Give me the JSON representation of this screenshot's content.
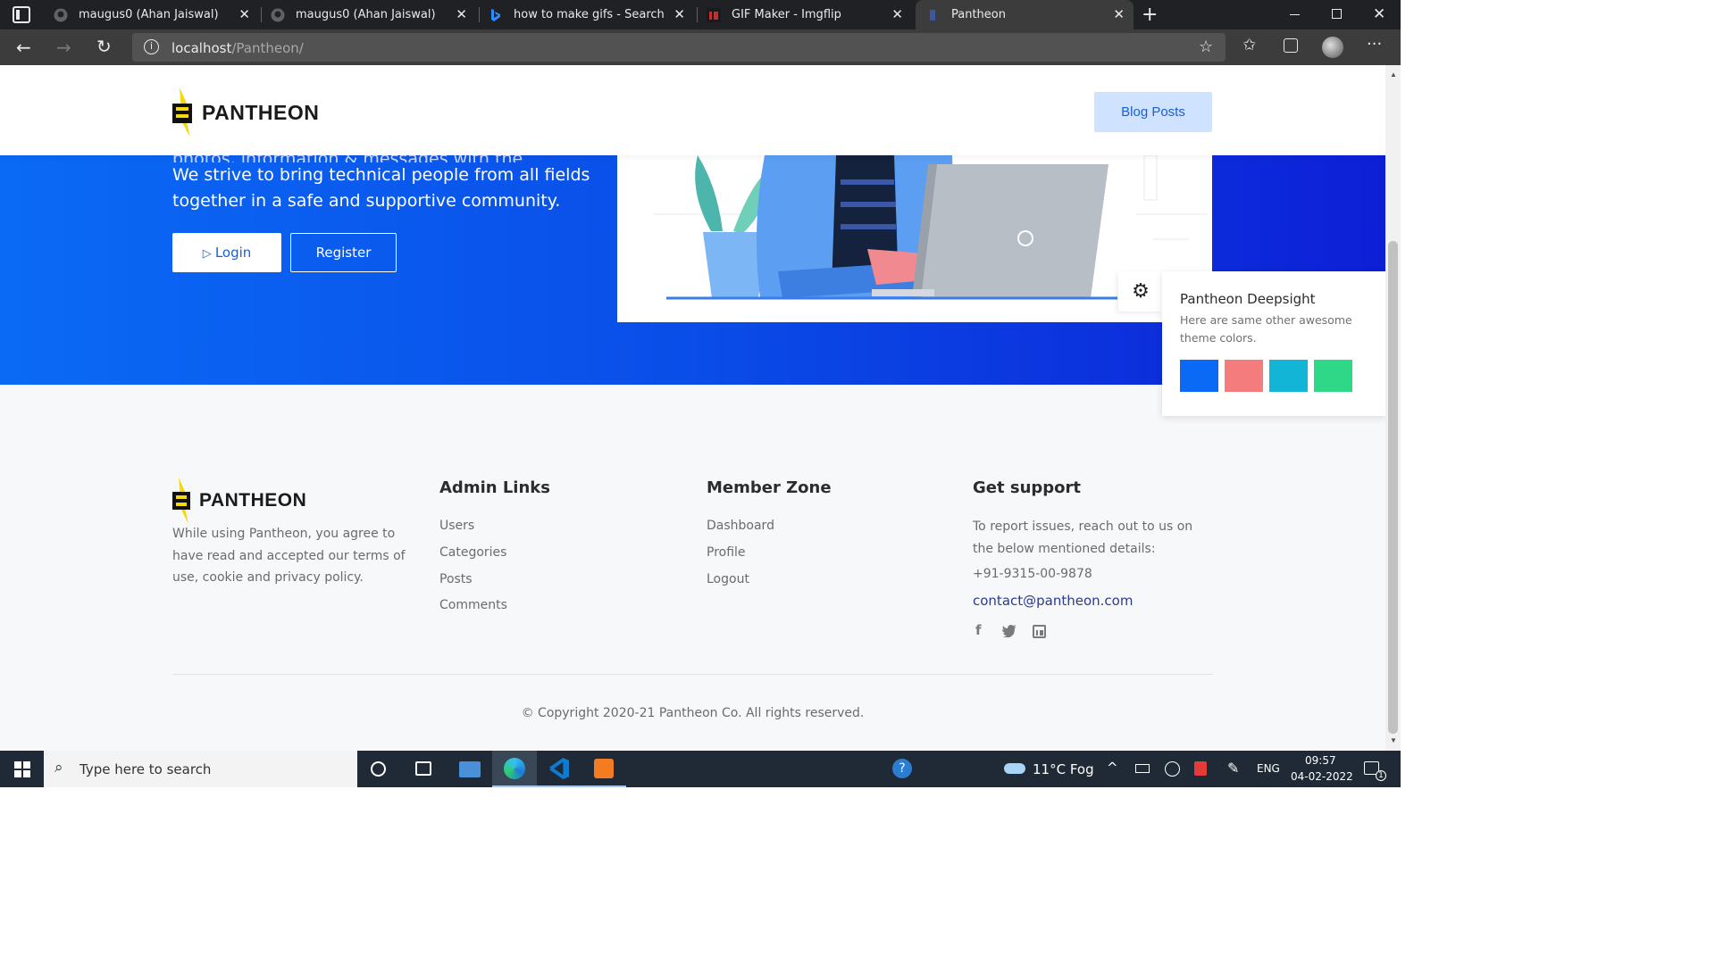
{
  "browser": {
    "tabs": [
      {
        "title": "maugus0 (Ahan Jaiswal)",
        "icon": "github-icon"
      },
      {
        "title": "maugus0 (Ahan Jaiswal)",
        "icon": "github-icon"
      },
      {
        "title": "how to make gifs - Search",
        "icon": "bing-icon"
      },
      {
        "title": "GIF Maker - Imgflip",
        "icon": "imgflip-icon"
      },
      {
        "title": "Pantheon",
        "icon": "page-icon",
        "active": true
      }
    ],
    "url_host": "localhost",
    "url_path": "/Pantheon/"
  },
  "header": {
    "logo_text": "PANTHEON",
    "blog_button": "Blog Posts"
  },
  "hero": {
    "text_cut": "photos, information & messages with the community.",
    "line1": "We strive to bring technical people from all fields",
    "line2": "together in a safe and supportive community.",
    "login_label": "Login",
    "register_label": "Register"
  },
  "footer": {
    "logo_text": "PANTHEON",
    "about_lines": [
      "While using Pantheon, you agree to",
      "have read and accepted our terms of",
      "use, cookie and privacy policy."
    ],
    "admin_heading": "Admin Links",
    "admin_links": [
      "Users",
      "Categories",
      "Posts",
      "Comments"
    ],
    "member_heading": "Member Zone",
    "member_links": [
      "Dashboard",
      "Profile",
      "Logout"
    ],
    "support_heading": "Get support",
    "support_lines": [
      "To report issues, reach out to us on",
      "the below mentioned details:"
    ],
    "phone": "+91-9315-00-9878",
    "email": "contact@pantheon.com",
    "copyright": "© Copyright 2020-21 Pantheon Co. All rights reserved."
  },
  "theme_panel": {
    "title": "Pantheon Deepsight",
    "description": "Here are same other awesome theme colors.",
    "swatches": [
      "#0a6af5",
      "#f47c7c",
      "#13b5d6",
      "#2fd887"
    ]
  },
  "taskbar": {
    "search_placeholder": "Type here to search",
    "weather": "11°C  Fog",
    "language": "ENG",
    "time": "09:57",
    "date": "04-02-2022",
    "notification_count": "1"
  },
  "colors": {
    "accent": "#0a6af5",
    "hero_end": "#0d1fd6",
    "blog_button_bg": "#cfe2ff"
  }
}
